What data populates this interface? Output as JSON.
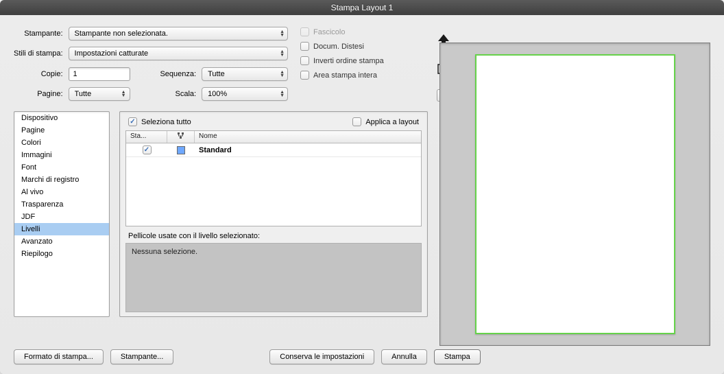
{
  "window": {
    "title": "Stampa Layout 1"
  },
  "form": {
    "printer_label": "Stampante:",
    "printer_value": "Stampante non selezionata.",
    "styles_label": "Stili di stampa:",
    "styles_value": "Impostazioni catturate",
    "copies_label": "Copie:",
    "copies_value": "1",
    "sequence_label": "Sequenza:",
    "sequence_value": "Tutte",
    "pages_label": "Pagine:",
    "pages_value": "Tutte",
    "scale_label": "Scala:",
    "scale_value": "100%"
  },
  "checkboxes": {
    "fascicolo": "Fascicolo",
    "docum_distesi": "Docum. Distesi",
    "inverti": "Inverti ordine stampa",
    "area_intera": "Area stampa intera"
  },
  "help": "?",
  "sidebar": {
    "items": [
      "Dispositivo",
      "Pagine",
      "Colori",
      "Immagini",
      "Font",
      "Marchi di registro",
      "Al vivo",
      "Trasparenza",
      "JDF",
      "Livelli",
      "Avanzato",
      "Riepilogo"
    ],
    "selected_index": 9
  },
  "detail": {
    "select_all": "Seleziona tutto",
    "apply_layout": "Applica a layout",
    "columns": {
      "c1": "Sta...",
      "c2": "",
      "c3": "Nome"
    },
    "row": {
      "name": "Standard"
    },
    "pellicole_label": "Pellicole usate con il livello selezionato:",
    "pellicole_text": "Nessuna selezione."
  },
  "buttons": {
    "page_setup": "Formato di stampa...",
    "printer": "Stampante...",
    "save_settings": "Conserva le impostazioni",
    "cancel": "Annulla",
    "print": "Stampa"
  }
}
